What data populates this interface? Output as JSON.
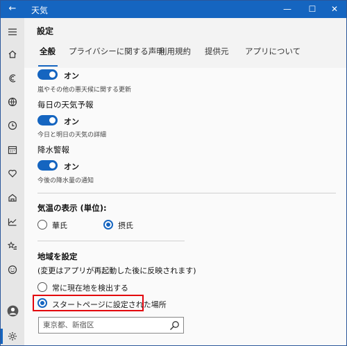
{
  "titlebar": {
    "title": "天気",
    "back_glyph": "←",
    "minimize_glyph": "—",
    "maximize_glyph": "☐",
    "close_glyph": "✕"
  },
  "page": {
    "title": "設定"
  },
  "tabs": [
    {
      "label": "全般",
      "active": true
    },
    {
      "label": "プライバシーに関する声明",
      "active": false
    },
    {
      "label": "利用規約",
      "active": false
    },
    {
      "label": "提供元",
      "active": false
    },
    {
      "label": "アプリについて",
      "active": false
    }
  ],
  "notifications": {
    "severe": {
      "state": "オン",
      "desc": "嵐やその他の悪天候に関する更新"
    },
    "daily_heading": "毎日の天気予報",
    "daily": {
      "state": "オン",
      "desc": "今日と明日の天気の詳細"
    },
    "precip_heading": "降水警報",
    "precip": {
      "state": "オン",
      "desc": "今後の降水量の通知"
    }
  },
  "temperature": {
    "heading": "気温の表示 (単位):",
    "options": [
      {
        "label": "華氏",
        "checked": false
      },
      {
        "label": "摂氏",
        "checked": true
      }
    ]
  },
  "location": {
    "heading": "地域を設定",
    "note": "(変更はアプリが再起動した後に反映されます)",
    "options": [
      {
        "label": "常に現在地を検出する",
        "checked": false
      },
      {
        "label": "スタートページに設定された場所",
        "checked": true
      }
    ],
    "search_placeholder": "東京都、新宿区"
  },
  "colors": {
    "accent": "#1565c0",
    "highlight": "#e3000b"
  },
  "sidebar_icons": [
    "hamburger-icon",
    "home-icon",
    "forecast-icon",
    "maps-icon",
    "history-icon",
    "calendar-icon",
    "places-icon",
    "news-icon",
    "trends-icon",
    "favorites-icon",
    "feedback-icon",
    "account-icon",
    "settings-icon"
  ]
}
